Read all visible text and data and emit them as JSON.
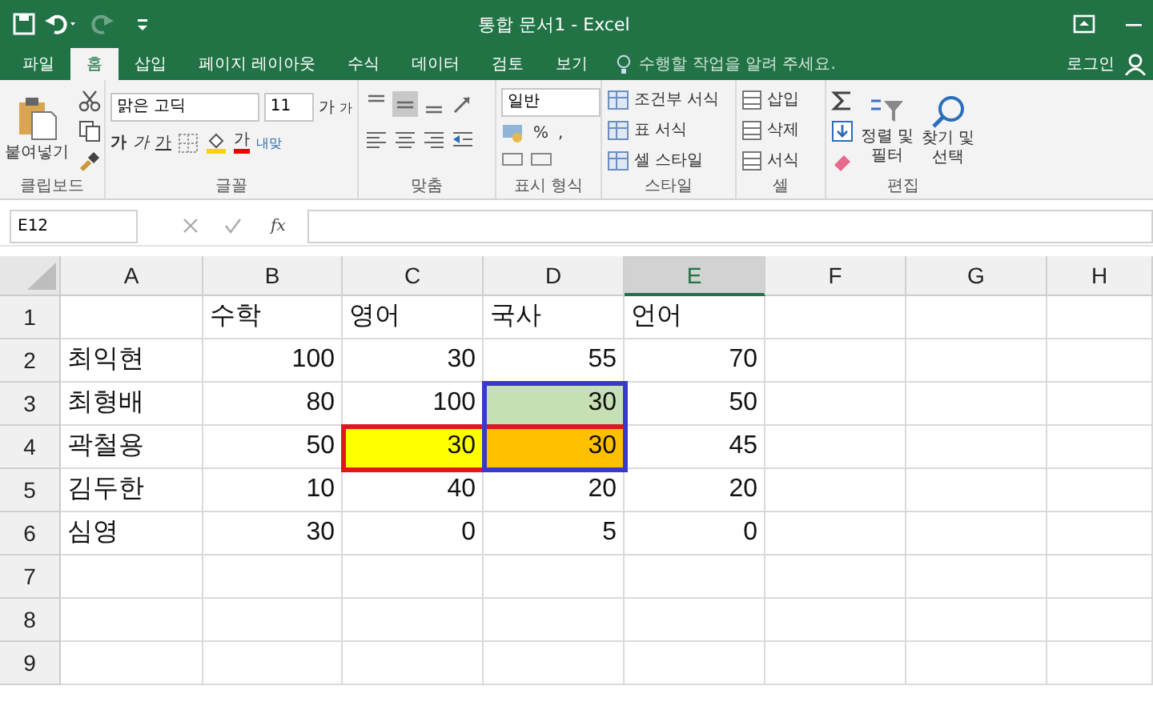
{
  "title_bar": {
    "title": "통합 문서1 - Excel",
    "redo_disabled": true
  },
  "tabs": [
    {
      "label": "파일",
      "selected": false
    },
    {
      "label": "홈",
      "selected": true
    },
    {
      "label": "삽입",
      "selected": false
    },
    {
      "label": "페이지 레이아웃",
      "selected": false
    },
    {
      "label": "수식",
      "selected": false
    },
    {
      "label": "데이터",
      "selected": false
    },
    {
      "label": "검토",
      "selected": false
    },
    {
      "label": "보기",
      "selected": false
    }
  ],
  "tell_me": {
    "placeholder": "수행할 작업을 알려 주세요."
  },
  "sign_in": "로그인",
  "ribbon": {
    "clipboard": {
      "paste": "붙여넣기",
      "label": "클립보드"
    },
    "font": {
      "font_name": "맑은 고딕",
      "font_size": "11",
      "grow": "가",
      "shrink": "가",
      "bold": "가",
      "italic": "가",
      "underline": "가",
      "font_color": "가",
      "wrap": "내맞",
      "label": "글꼴"
    },
    "alignment": {
      "label": "맞춤",
      "vertical": [
        {
          "selected": false
        },
        {
          "selected": true
        },
        {
          "selected": false
        }
      ]
    },
    "number": {
      "format": "일반",
      "percent": "%",
      "comma": ",",
      "label": "표시 형식"
    },
    "styles": {
      "items": [
        "조건부 서식",
        "표 서식",
        "셀 스타일"
      ],
      "label": "스타일"
    },
    "cells": {
      "items": [
        "삽입",
        "삭제",
        "서식"
      ],
      "label": "셀"
    },
    "editing": {
      "sort": "정렬 및 필터",
      "find": "찾기 및 선택",
      "label": "편집"
    }
  },
  "name_box": "E12",
  "fx": "fx",
  "columns": [
    {
      "label": "A",
      "selected": false
    },
    {
      "label": "B",
      "selected": false
    },
    {
      "label": "C",
      "selected": false
    },
    {
      "label": "D",
      "selected": false
    },
    {
      "label": "E",
      "selected": true
    },
    {
      "label": "F",
      "selected": false
    },
    {
      "label": "G",
      "selected": false
    },
    {
      "label": "H",
      "selected": false
    }
  ],
  "header_row": {
    "label": "1",
    "titles": [
      "수학",
      "영어",
      "국사",
      "언어"
    ]
  },
  "rows": [
    {
      "label": "2",
      "name": "최익현",
      "scores": [
        {
          "text": "100"
        },
        {
          "text": "30"
        },
        {
          "text": "55"
        },
        {
          "text": "70"
        }
      ]
    },
    {
      "label": "3",
      "name": "최형배",
      "scores": [
        {
          "text": "80"
        },
        {
          "text": "100"
        },
        {
          "text": "30",
          "color": "#c6e0b4",
          "in_blue_box": true
        },
        {
          "text": "50"
        }
      ]
    },
    {
      "label": "4",
      "name": "곽철용",
      "scores": [
        {
          "text": "50"
        },
        {
          "text": "30",
          "color": "#ffff00",
          "in_red_box": true
        },
        {
          "text": "30",
          "color": "#ffc000",
          "in_red_box": true,
          "in_blue_box": true
        },
        {
          "text": "45"
        }
      ]
    },
    {
      "label": "5",
      "name": "김두한",
      "scores": [
        {
          "text": "10"
        },
        {
          "text": "40"
        },
        {
          "text": "20"
        },
        {
          "text": "20"
        }
      ]
    },
    {
      "label": "6",
      "name": "심영",
      "scores": [
        {
          "text": "30"
        },
        {
          "text": "0"
        },
        {
          "text": "5"
        },
        {
          "text": "0"
        }
      ]
    }
  ],
  "empty_rows": [
    "7",
    "8",
    "9"
  ]
}
